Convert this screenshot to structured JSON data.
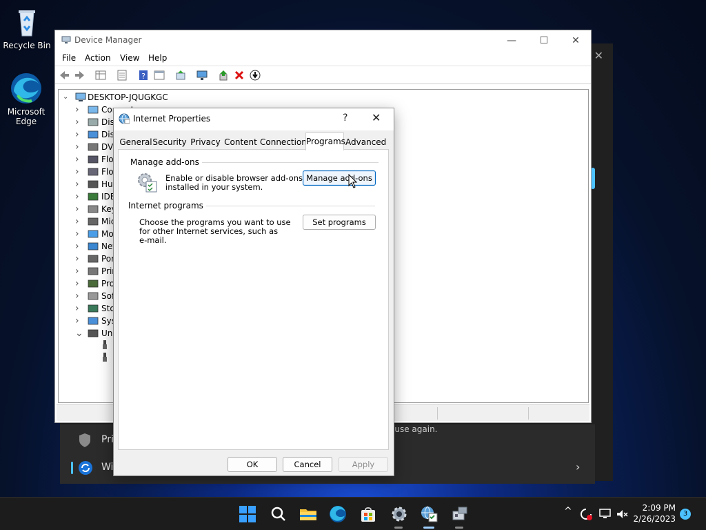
{
  "desktop": {
    "icons": [
      {
        "label": "Recycle Bin",
        "icon": "recycle-bin-icon"
      },
      {
        "label": "Microsoft Edge",
        "icon": "edge-icon"
      }
    ]
  },
  "background_window": {
    "row1_text": "Pri",
    "row1_right_text": "ause again.",
    "row2_text": "Wi"
  },
  "device_manager": {
    "title": "Device Manager",
    "menu": [
      "File",
      "Action",
      "View",
      "Help"
    ],
    "root": "DESKTOP-JQUGKGC",
    "items": [
      {
        "label": "Computer",
        "icon": "computer-icon",
        "expanded": false
      },
      {
        "label": "Dis",
        "icon": "disk-drive-icon",
        "expanded": false
      },
      {
        "label": "Dis",
        "icon": "display-adapter-icon",
        "expanded": false
      },
      {
        "label": "DVI",
        "icon": "dvd-drive-icon",
        "expanded": false
      },
      {
        "label": "Flo",
        "icon": "floppy-drive-icon",
        "expanded": false
      },
      {
        "label": "Flo",
        "icon": "floppy-controller-icon",
        "expanded": false
      },
      {
        "label": "Hu",
        "icon": "hid-icon",
        "expanded": false
      },
      {
        "label": "IDE",
        "icon": "ide-controller-icon",
        "expanded": false
      },
      {
        "label": "Key",
        "icon": "keyboard-icon",
        "expanded": false
      },
      {
        "label": "Mic",
        "icon": "mouse-icon",
        "expanded": false
      },
      {
        "label": "Mo",
        "icon": "monitor-icon",
        "expanded": false
      },
      {
        "label": "Net",
        "icon": "network-adapter-icon",
        "expanded": false
      },
      {
        "label": "Por",
        "icon": "ports-icon",
        "expanded": false
      },
      {
        "label": "Prin",
        "icon": "print-queue-icon",
        "expanded": false
      },
      {
        "label": "Pro",
        "icon": "processor-icon",
        "expanded": false
      },
      {
        "label": "Sof",
        "icon": "software-device-icon",
        "expanded": false
      },
      {
        "label": "Sto",
        "icon": "storage-controller-icon",
        "expanded": false
      },
      {
        "label": "Sys",
        "icon": "system-device-icon",
        "expanded": false
      },
      {
        "label": "Uni",
        "icon": "usb-controller-icon",
        "expanded": true
      }
    ]
  },
  "internet_properties": {
    "title": "Internet Properties",
    "help_glyph": "?",
    "close_glyph": "✕",
    "tabs": [
      "General",
      "Security",
      "Privacy",
      "Content",
      "Connections",
      "Programs",
      "Advanced"
    ],
    "active_tab": "Programs",
    "manage_addons": {
      "group_label": "Manage add-ons",
      "description_line1": "Enable or disable browser add-ons",
      "description_line2": "installed in your system.",
      "button": "Manage add-ons"
    },
    "internet_programs": {
      "group_label": "Internet programs",
      "description_line1": "Choose the programs you want to use",
      "description_line2": "for other Internet services, such as",
      "description_line3": "e-mail.",
      "button": "Set programs"
    },
    "footer": {
      "ok": "OK",
      "cancel": "Cancel",
      "apply": "Apply"
    }
  },
  "taskbar": {
    "time": "2:09 PM",
    "date": "2/26/2023",
    "notification_count": "3",
    "tray_chevron": "^"
  }
}
